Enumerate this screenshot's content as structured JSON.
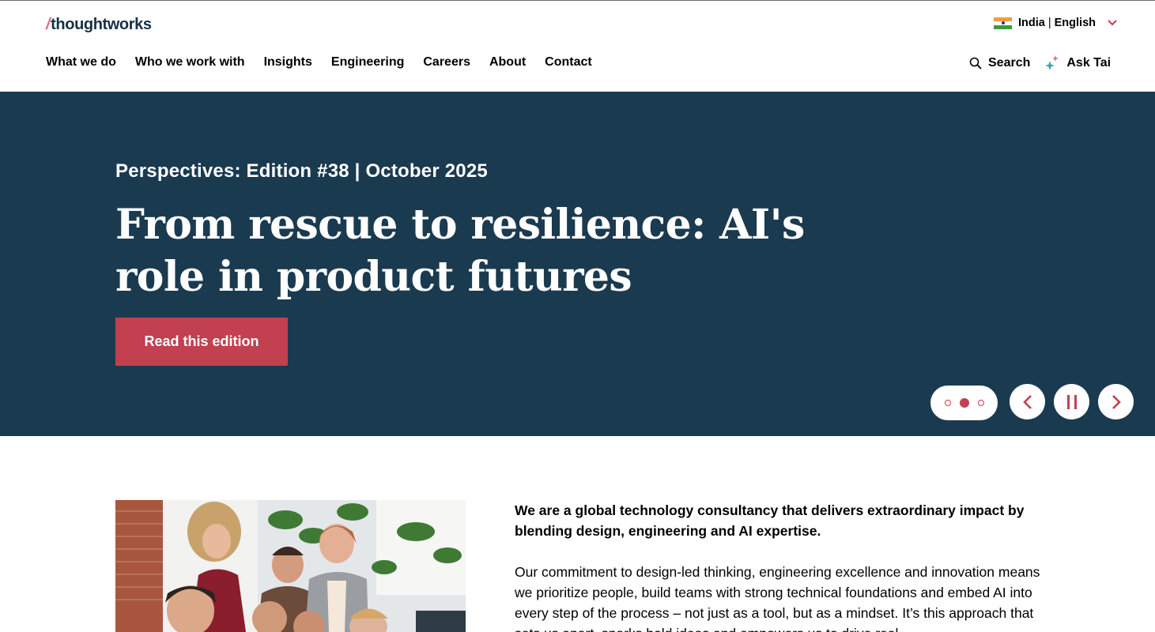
{
  "brand": {
    "logo_slash": "/",
    "logo_text": "thoughtworks"
  },
  "locale": {
    "country": "India",
    "separator": "|",
    "language": "English",
    "icon": "india-flag-icon"
  },
  "nav": [
    {
      "label": "What we do"
    },
    {
      "label": "Who we work with"
    },
    {
      "label": "Insights"
    },
    {
      "label": "Engineering"
    },
    {
      "label": "Careers"
    },
    {
      "label": "About"
    },
    {
      "label": "Contact"
    }
  ],
  "tools": {
    "search_label": "Search",
    "search_icon": "search-icon",
    "ask_label": "Ask Tai",
    "ask_icon": "sparkle-icon"
  },
  "hero": {
    "kicker": "Perspectives: Edition #38 | October 2025",
    "headline": "From rescue to resilience: AI's role in product futures",
    "cta_label": "Read this edition",
    "carousel": {
      "slide_count": 3,
      "active_slide": 2,
      "state": "playing"
    },
    "background": "#1a3a50",
    "accent": "#c2404f"
  },
  "about": {
    "lead": "We are a global technology consultancy that delivers extraordinary impact by blending design, engineering and AI expertise.",
    "body": "Our commitment to design-led thinking, engineering excellence and innovation means we prioritize people, build teams with strong technical foundations and embed AI into every step of the process – not just as a tool, but as a mindset. It’s this approach that sets us apart, sparks bold ideas and empowers us to drive real"
  }
}
